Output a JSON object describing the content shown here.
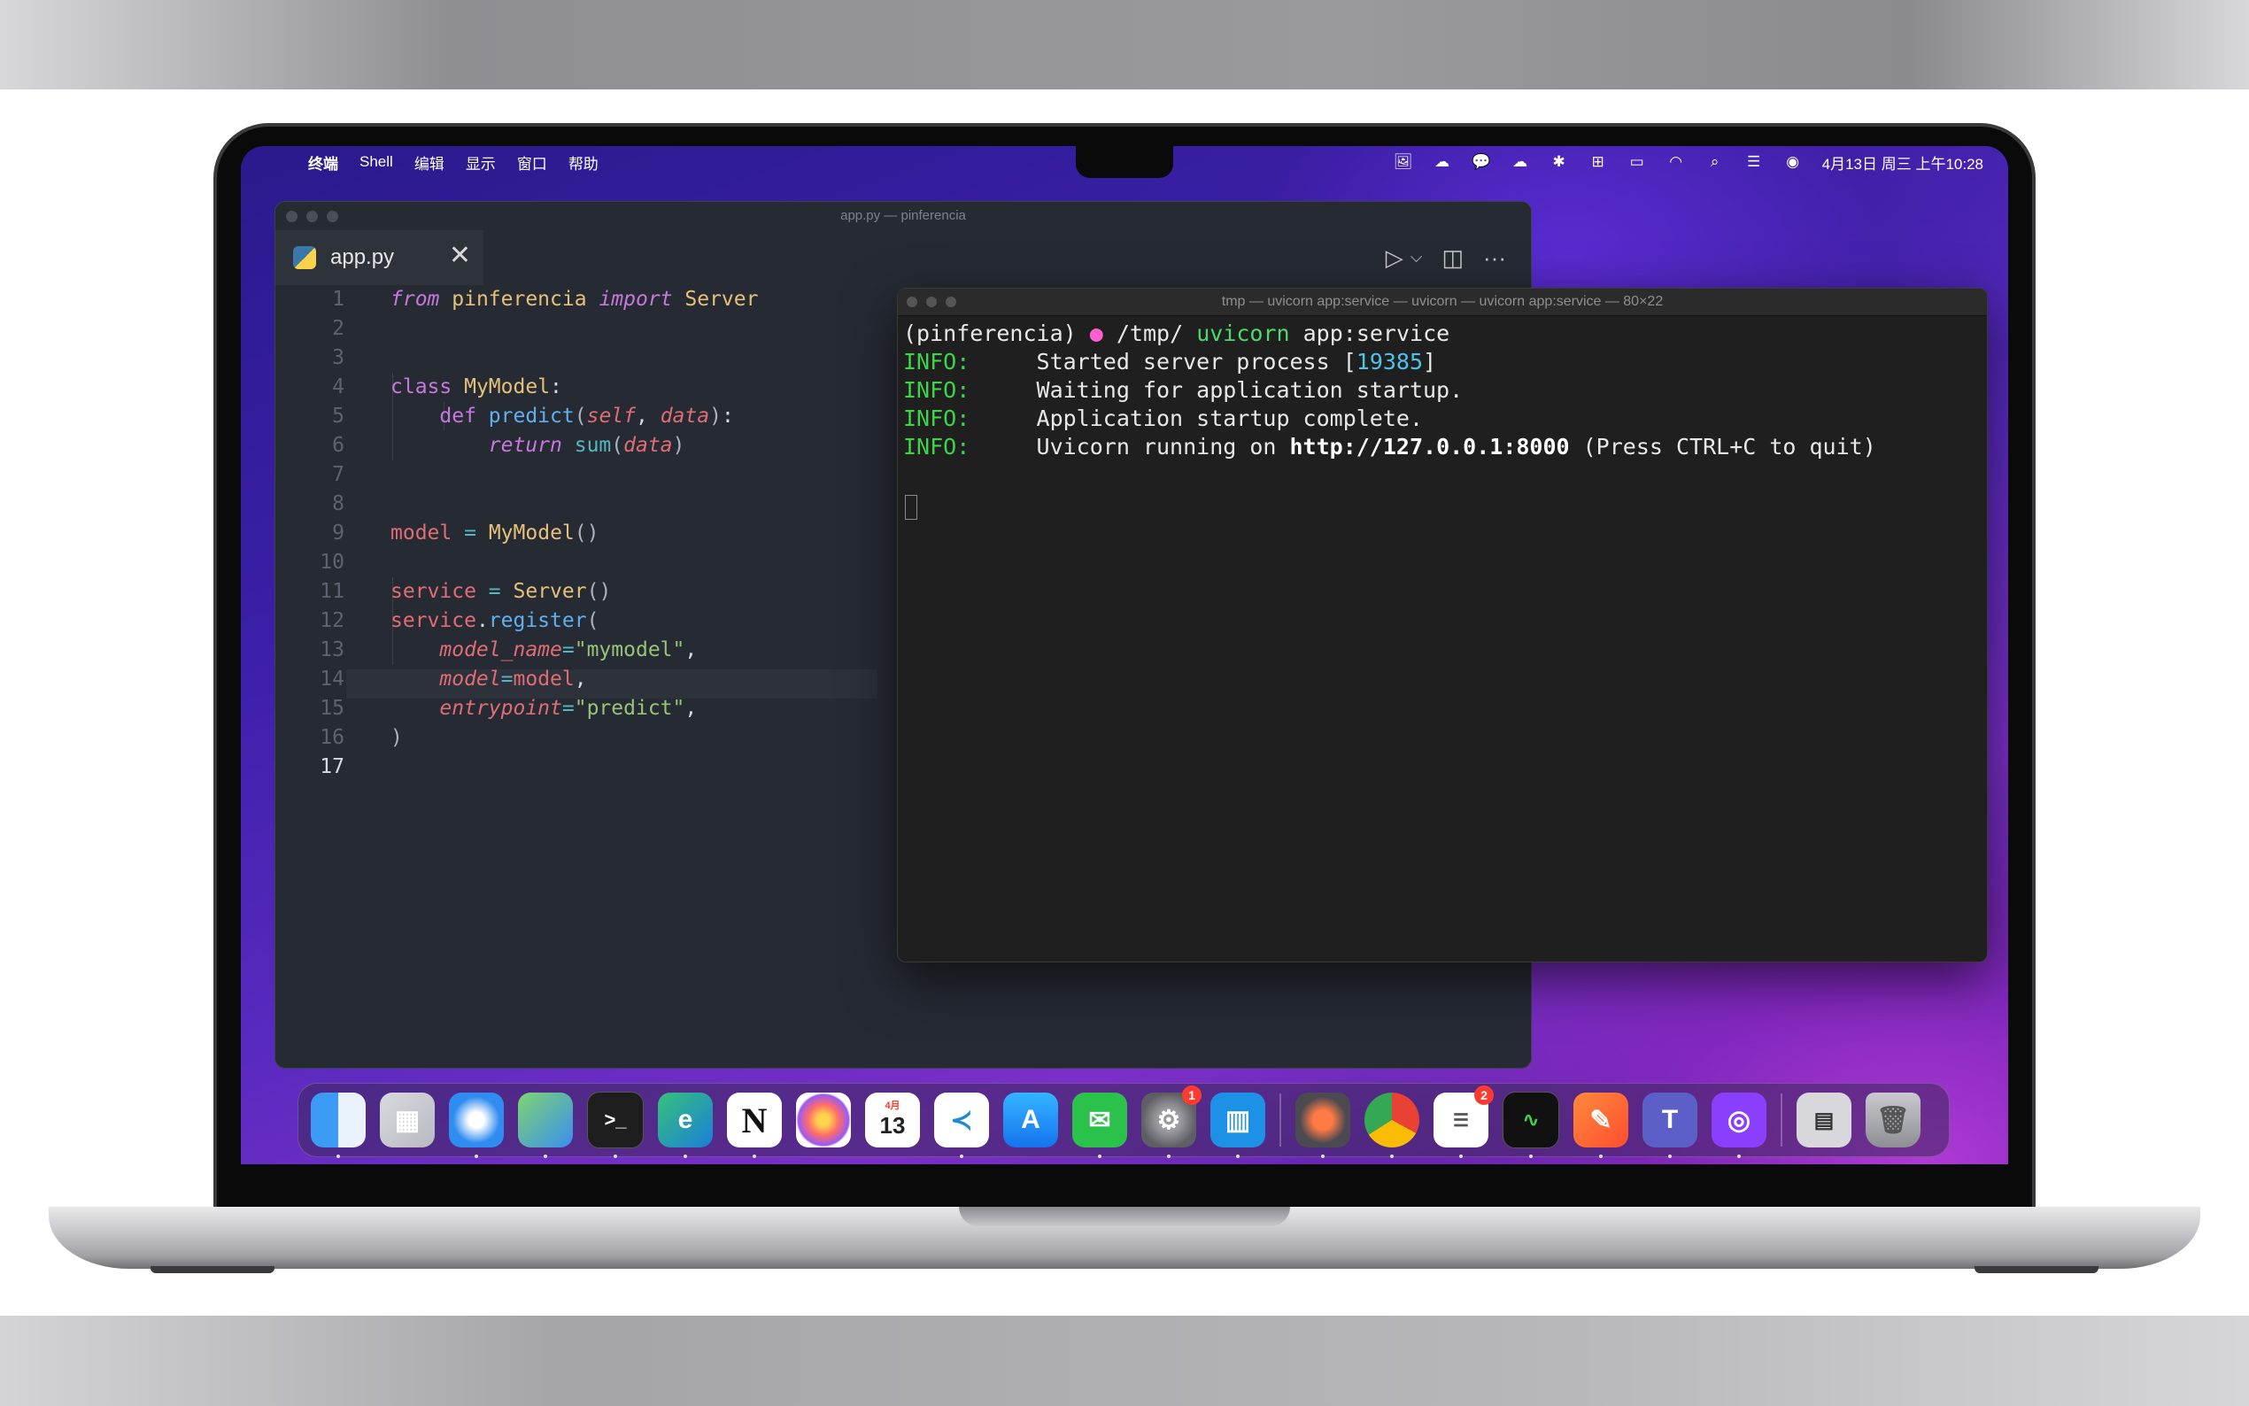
{
  "menubar": {
    "apple": "",
    "menus": [
      "终端",
      "Shell",
      "编辑",
      "显示",
      "窗口",
      "帮助"
    ],
    "clock": "4月13日 周三 上午10:28"
  },
  "editor": {
    "window_title": "app.py — pinferencia",
    "tab_label": "app.py",
    "tab_close": "✕",
    "run_icon": "▷",
    "chevron_icon": "⌵",
    "split_icon": "◫",
    "more_icon": "···",
    "line_numbers": [
      "1",
      "2",
      "3",
      "4",
      "5",
      "6",
      "7",
      "8",
      "9",
      "10",
      "11",
      "12",
      "13",
      "14",
      "15",
      "16",
      "17"
    ]
  },
  "terminal": {
    "title": "tmp — uvicorn app:service — uvicorn — uvicorn app:service — 80×22",
    "prompt_env": "(pinferencia)",
    "prompt_path": "/tmp/",
    "prompt_cmd": "uvicorn",
    "prompt_arg": "app:service",
    "log": [
      {
        "level": "INFO:",
        "msg_pre": "     Started server process [",
        "pid": "19385",
        "msg_post": "]"
      },
      {
        "level": "INFO:",
        "msg": "     Waiting for application startup."
      },
      {
        "level": "INFO:",
        "msg": "     Application startup complete."
      },
      {
        "level": "INFO:",
        "msg_pre": "     Uvicorn running on ",
        "url": "http://127.0.0.1:8000",
        "msg_post": " (Press CTRL+C to quit)"
      }
    ]
  },
  "dock": {
    "badges": {
      "settings": "1",
      "reminders": "2"
    },
    "notion_glyph": "N",
    "calendar": {
      "month": "4月",
      "day": "13"
    },
    "terminal_glyph": ">_"
  },
  "colors": {
    "keyword": "#c678dd",
    "class": "#e5c07b",
    "function": "#61afef",
    "variable": "#e06c75",
    "string": "#98c379",
    "terminal_info": "#3fd34a"
  }
}
